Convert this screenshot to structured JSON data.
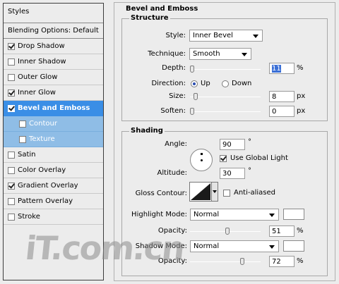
{
  "left": {
    "styles_header": "Styles",
    "blending_options": "Blending Options: Default",
    "items": [
      {
        "label": "Drop Shadow",
        "checked": true
      },
      {
        "label": "Inner Shadow",
        "checked": false
      },
      {
        "label": "Outer Glow",
        "checked": false
      },
      {
        "label": "Inner Glow",
        "checked": true
      },
      {
        "label": "Bevel and Emboss",
        "checked": true
      },
      {
        "label": "Contour",
        "checked": false
      },
      {
        "label": "Texture",
        "checked": false
      },
      {
        "label": "Satin",
        "checked": false
      },
      {
        "label": "Color Overlay",
        "checked": false
      },
      {
        "label": "Gradient Overlay",
        "checked": true
      },
      {
        "label": "Pattern Overlay",
        "checked": false
      },
      {
        "label": "Stroke",
        "checked": false
      }
    ]
  },
  "panel": {
    "title": "Bevel and Emboss",
    "structure": {
      "legend": "Structure",
      "style_label": "Style:",
      "style_value": "Inner Bevel",
      "technique_label": "Technique:",
      "technique_value": "Smooth",
      "depth_label": "Depth:",
      "depth_value": "11",
      "depth_unit": "%",
      "direction_label": "Direction:",
      "dir_up": "Up",
      "dir_down": "Down",
      "size_label": "Size:",
      "size_value": "8",
      "size_unit": "px",
      "soften_label": "Soften:",
      "soften_value": "0",
      "soften_unit": "px"
    },
    "shading": {
      "legend": "Shading",
      "angle_label": "Angle:",
      "angle_value": "90",
      "angle_unit": "°",
      "global_light_label": "Use Global Light",
      "altitude_label": "Altitude:",
      "altitude_value": "30",
      "altitude_unit": "°",
      "gloss_label": "Gloss Contour:",
      "anti_aliased_label": "Anti-aliased",
      "highlight_mode_label": "Highlight Mode:",
      "highlight_mode_value": "Normal",
      "highlight_opacity_label": "Opacity:",
      "highlight_opacity_value": "51",
      "highlight_opacity_unit": "%",
      "shadow_mode_label": "Shadow Mode:",
      "shadow_mode_value": "Normal",
      "shadow_opacity_label": "Opacity:",
      "shadow_opacity_value": "72",
      "shadow_opacity_unit": "%"
    }
  },
  "watermark": "iT.com.cn",
  "colors": {
    "selected": "#3a8ee6",
    "sub_item": "#8fbde6",
    "highlight_text": "#3a6fd6"
  }
}
